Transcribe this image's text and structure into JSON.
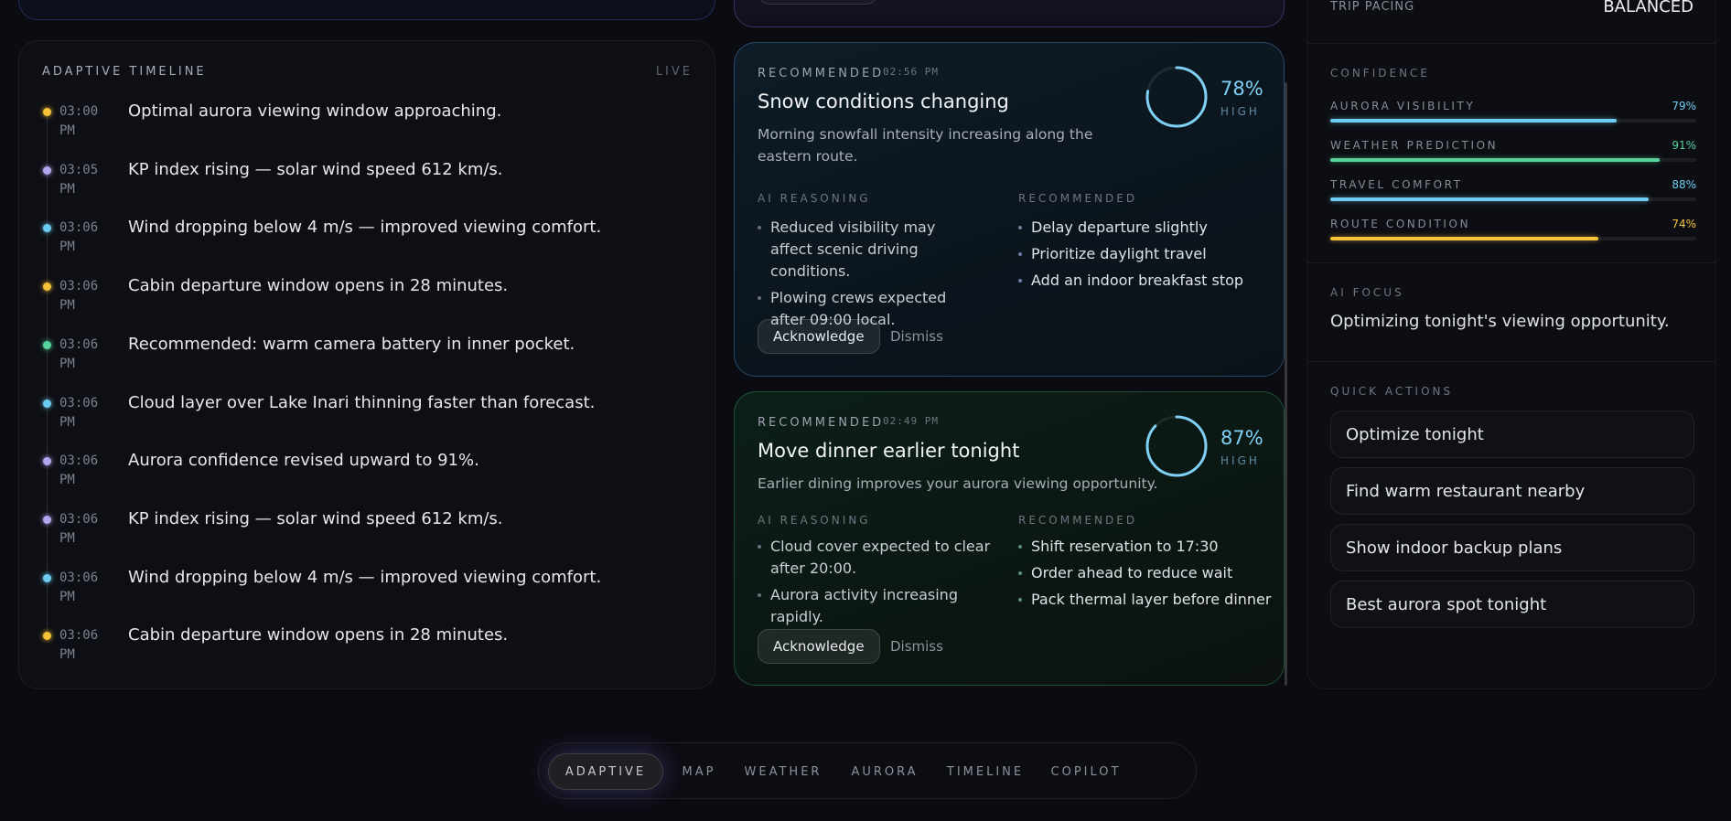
{
  "trip_pacing": {
    "label": "TRIP PACING",
    "value": "BALANCED"
  },
  "timeline": {
    "title": "ADAPTIVE TIMELINE",
    "status": "LIVE",
    "items": [
      {
        "time": "03:00 PM",
        "text": "Optimal aurora viewing window approaching.",
        "color": "#f5c23a"
      },
      {
        "time": "03:05 PM",
        "text": "KP index rising — solar wind speed 612 km/s.",
        "color": "#b3a6ee"
      },
      {
        "time": "03:06 PM",
        "text": "Wind dropping below 4 m/s — improved viewing comfort.",
        "color": "#6dcdf0"
      },
      {
        "time": "03:06 PM",
        "text": "Cabin departure window opens in 28 minutes.",
        "color": "#f5c23a"
      },
      {
        "time": "03:06 PM",
        "text": "Recommended: warm camera battery in inner pocket.",
        "color": "#56d49b"
      },
      {
        "time": "03:06 PM",
        "text": "Cloud layer over Lake Inari thinning faster than forecast.",
        "color": "#6dcdf0"
      },
      {
        "time": "03:06 PM",
        "text": "Aurora confidence revised upward to 91%.",
        "color": "#b3a6ee"
      },
      {
        "time": "03:06 PM",
        "text": "KP index rising — solar wind speed 612 km/s.",
        "color": "#b3a6ee"
      },
      {
        "time": "03:06 PM",
        "text": "Wind dropping below 4 m/s — improved viewing comfort.",
        "color": "#6dcdf0"
      },
      {
        "time": "03:06 PM",
        "text": "Cabin departure window opens in 28 minutes.",
        "color": "#f5c23a"
      }
    ]
  },
  "cards": [
    {
      "label": "RECOMMENDED",
      "time": "02:56 PM",
      "title": "Snow conditions changing",
      "description": "Morning snowfall intensity increasing along the eastern route.",
      "confidence": 78,
      "confidence_text": "78%",
      "confidence_level": "HIGH",
      "reasoning_label": "AI REASONING",
      "reasoning": [
        "Reduced visibility may affect scenic driving conditions.",
        "Plowing crews expected after 09:00 local."
      ],
      "recommended_label": "RECOMMENDED",
      "recommended": [
        "Delay departure slightly",
        "Prioritize daylight travel",
        "Add an indoor breakfast stop"
      ],
      "ack_label": "Acknowledge",
      "dismiss_label": "Dismiss"
    },
    {
      "label": "RECOMMENDED",
      "time": "02:49 PM",
      "title": "Move dinner earlier tonight",
      "description": "Earlier dining improves your aurora viewing opportunity.",
      "confidence": 87,
      "confidence_text": "87%",
      "confidence_level": "HIGH",
      "reasoning_label": "AI REASONING",
      "reasoning": [
        "Cloud cover expected to clear after 20:00.",
        "Aurora activity increasing rapidly."
      ],
      "recommended_label": "RECOMMENDED",
      "recommended": [
        "Shift reservation to 17:30",
        "Order ahead to reduce wait",
        "Pack thermal layer before dinner"
      ],
      "ack_label": "Acknowledge",
      "dismiss_label": "Dismiss"
    }
  ],
  "confidence": {
    "title": "CONFIDENCE",
    "items": [
      {
        "label": "AURORA VISIBILITY",
        "value": 79,
        "value_text": "79%",
        "color": "#6dcdf0"
      },
      {
        "label": "WEATHER PREDICTION",
        "value": 91,
        "value_text": "91%",
        "color": "#56d49b"
      },
      {
        "label": "TRAVEL COMFORT",
        "value": 88,
        "value_text": "88%",
        "color": "#6dcdf0"
      },
      {
        "label": "ROUTE CONDITION",
        "value": 74,
        "value_text": "74%",
        "color": "#f5c23a"
      }
    ]
  },
  "ai_focus": {
    "label": "AI FOCUS",
    "text": "Optimizing tonight's viewing opportunity."
  },
  "quick_actions": {
    "title": "QUICK ACTIONS",
    "items": [
      "Optimize tonight",
      "Find warm restaurant nearby",
      "Show indoor backup plans",
      "Best aurora spot tonight"
    ]
  },
  "nav": {
    "active": "ADAPTIVE",
    "tabs": [
      "ADAPTIVE",
      "MAP",
      "WEATHER",
      "AURORA",
      "TIMELINE",
      "COPILOT"
    ]
  }
}
